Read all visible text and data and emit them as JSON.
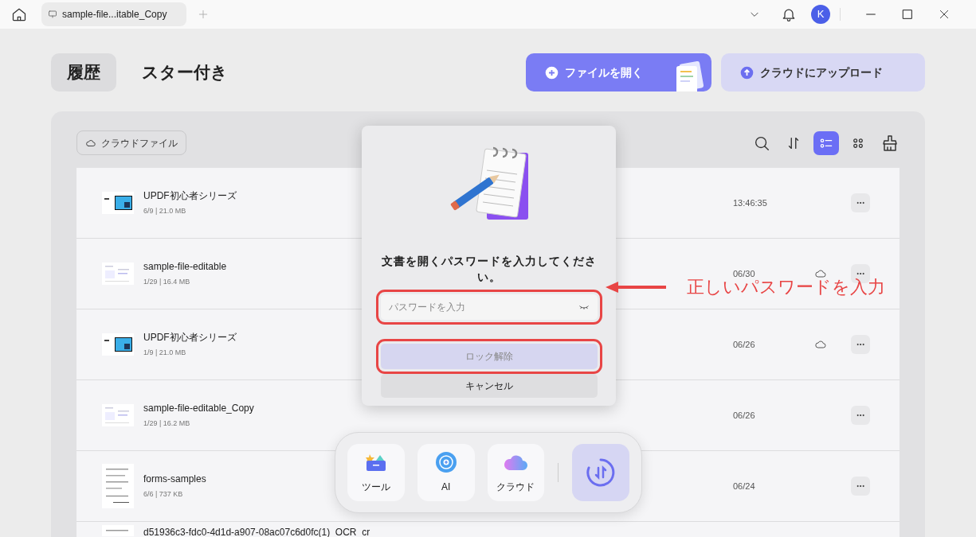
{
  "titlebar": {
    "tab_title": "sample-file...itable_Copy",
    "avatar": "K"
  },
  "tabs": [
    {
      "label": "履歴",
      "selected": true
    },
    {
      "label": "スター付き",
      "selected": false
    }
  ],
  "actions": [
    {
      "label": "ファイルを開く",
      "kind": "primary"
    },
    {
      "label": "クラウドにアップロード",
      "kind": "secondary"
    }
  ],
  "cloud_files_button": "クラウドファイル",
  "view_modes": [
    {
      "kind": "list",
      "selected": true
    },
    {
      "kind": "grid",
      "selected": false
    }
  ],
  "files": [
    {
      "name": "UPDF初心者シリーズ",
      "meta": "6/9 | 21.0 MB",
      "date": "13:46:35",
      "cloud": false,
      "kind": "slide"
    },
    {
      "name": "sample-file-editable",
      "meta": "1/29 | 16.4 MB",
      "date": "06/30",
      "cloud": true,
      "kind": "doc"
    },
    {
      "name": "UPDF初心者シリーズ",
      "meta": "1/9 | 21.0 MB",
      "date": "06/26",
      "cloud": true,
      "kind": "slide"
    },
    {
      "name": "sample-file-editable_Copy",
      "meta": "1/29 | 16.2 MB",
      "date": "06/26",
      "cloud": false,
      "kind": "doc"
    },
    {
      "name": "forms-samples",
      "meta": "6/6 | 737 KB",
      "date": "06/24",
      "cloud": false,
      "kind": "form"
    },
    {
      "name": "d51936c3-fdc0-4d1d-a907-08ac07c6d0fc(1)_OCR_cr",
      "cloud": false,
      "kind": "form"
    }
  ],
  "dialog": {
    "message": "文書を開くパスワードを入力してください。",
    "placeholder": "パスワードを入力",
    "unlock_label": "ロック解除",
    "cancel_label": "キャンセル"
  },
  "dock": [
    {
      "label": "ツール",
      "kind": "tools"
    },
    {
      "label": "AI",
      "kind": "ai"
    },
    {
      "label": "クラウド",
      "kind": "cloud"
    }
  ],
  "annotation": {
    "text": "正しいパスワードを入力"
  }
}
